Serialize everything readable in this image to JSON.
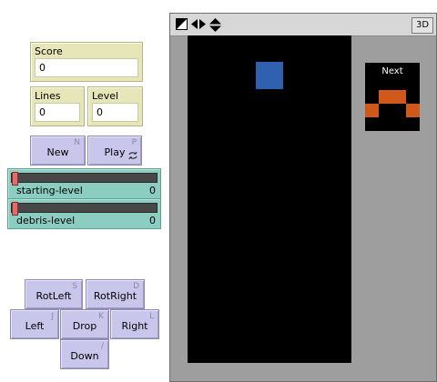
{
  "monitors": {
    "score": {
      "label": "Score",
      "value": "0"
    },
    "lines": {
      "label": "Lines",
      "value": "0"
    },
    "level": {
      "label": "Level",
      "value": "0"
    }
  },
  "buttons": {
    "new": {
      "label": "New",
      "key": "N"
    },
    "play": {
      "label": "Play",
      "key": "P",
      "forever_icon": "forever-icon"
    },
    "rotleft": {
      "label": "RotLeft",
      "key": "S"
    },
    "rotright": {
      "label": "RotRight",
      "key": "D"
    },
    "left": {
      "label": "Left",
      "key": "J"
    },
    "drop": {
      "label": "Drop",
      "key": "K"
    },
    "right": {
      "label": "Right",
      "key": "L"
    },
    "down": {
      "label": "Down",
      "key": "/"
    }
  },
  "sliders": {
    "starting_level": {
      "name": "starting-level",
      "value": "0",
      "level": 0
    },
    "debris_level": {
      "name": "debris-level",
      "value": "0",
      "level": 0
    }
  },
  "view": {
    "toolbar_icons": [
      "view-shape-icon",
      "horizontal-arrows-icon",
      "vertical-arrows-icon"
    ],
    "button_3d": "3D",
    "next_label": "Next",
    "colors": {
      "current_piece": "#3060b0",
      "next_piece": "#d0581a",
      "background": "#000000",
      "frame": "#9e9e9e"
    }
  }
}
